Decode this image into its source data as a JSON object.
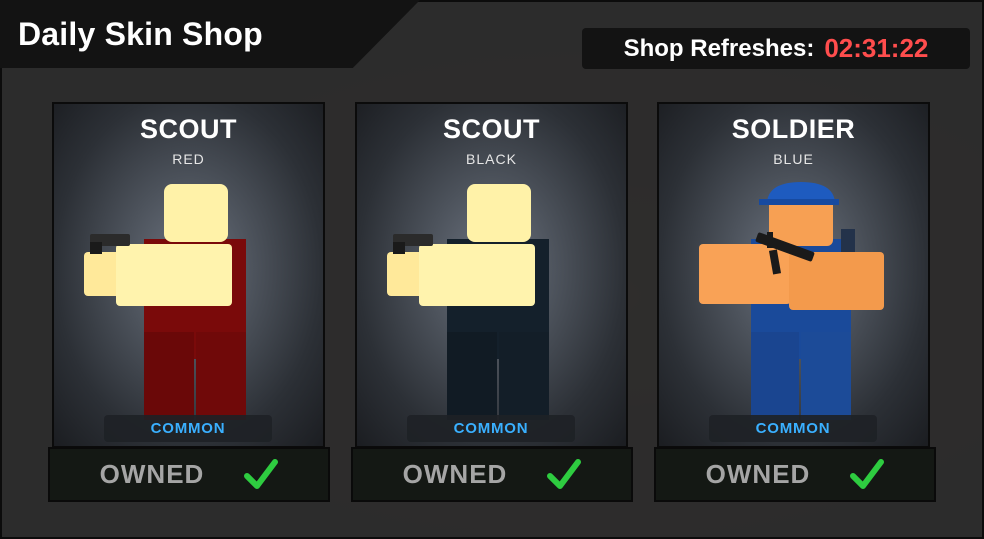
{
  "header": {
    "title": "Daily Skin Shop",
    "refresh_label": "Shop Refreshes:",
    "refresh_time": "02:31:22"
  },
  "cards": [
    {
      "name": "SCOUT",
      "variant": "RED",
      "rarity": "COMMON",
      "status": "OWNED",
      "outfit_color": "#7a0a0a"
    },
    {
      "name": "SCOUT",
      "variant": "BLACK",
      "rarity": "COMMON",
      "status": "OWNED",
      "outfit_color": "#14202b"
    },
    {
      "name": "SOLDIER",
      "variant": "BLUE",
      "rarity": "COMMON",
      "status": "OWNED",
      "outfit_color": "#1a4a9a"
    }
  ],
  "colors": {
    "refresh_accent": "#ff4d4d",
    "rarity_common": "#3ab0ff",
    "owned_check": "#2ecc40"
  },
  "icons": [
    "check-icon",
    "pistol-icon",
    "rifle-icon"
  ]
}
